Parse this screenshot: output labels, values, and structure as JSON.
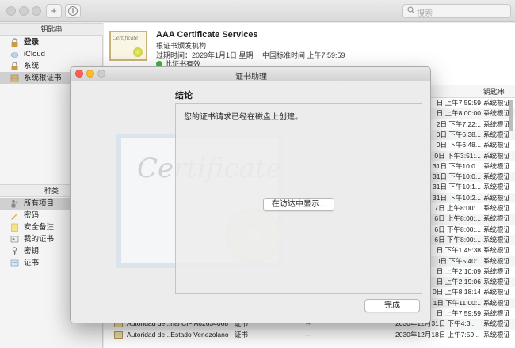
{
  "toolbar": {
    "search_placeholder": "搜索",
    "add_glyph": "+",
    "info_glyph": "i"
  },
  "sidebar": {
    "keychains_header": "钥匙串",
    "keychains": [
      {
        "label": "登录",
        "bold": true,
        "icon": "lock-icon"
      },
      {
        "label": "iCloud",
        "icon": "cloud-icon"
      },
      {
        "label": "系统",
        "icon": "lock-icon"
      },
      {
        "label": "系统根证书",
        "icon": "cabinet-icon",
        "selected": true
      }
    ],
    "categories_header": "种类",
    "categories": [
      {
        "label": "所有项目",
        "icon": "people-icon",
        "selected": true
      },
      {
        "label": "密码",
        "icon": "pencil-icon"
      },
      {
        "label": "安全备注",
        "icon": "note-icon"
      },
      {
        "label": "我的证书",
        "icon": "my-cert-icon"
      },
      {
        "label": "密钥",
        "icon": "key-icon"
      },
      {
        "label": "证书",
        "icon": "certificate-icon"
      }
    ]
  },
  "cert_info": {
    "title": "AAA Certificate Services",
    "subtitle": "根证书颁发机构",
    "expiry": "过期时间：2029年1月1日 星期一 中国标准时间 上午7:59:59",
    "valid": "此证书有效",
    "thumb_text": "Certificate"
  },
  "table": {
    "header_last": "钥匙串",
    "rows": [
      {
        "date": "日 上午7:59:59",
        "keychain": "系统根证"
      },
      {
        "date": "日 上午8:00:00",
        "keychain": "系统根证"
      },
      {
        "date": "2日 下午7:22:..",
        "keychain": "系统根证"
      },
      {
        "date": "0日 下午6:38...",
        "keychain": "系统根证"
      },
      {
        "date": "0日 下午6:48...",
        "keychain": "系统根证"
      },
      {
        "date": "0日 下午3:51:...",
        "keychain": "系统根证"
      },
      {
        "date": "31日 下午10:0...",
        "keychain": "系统根证"
      },
      {
        "date": "31日 下午10:0...",
        "keychain": "系统根证"
      },
      {
        "date": "31日 下午10:1...",
        "keychain": "系统根证"
      },
      {
        "date": "31日 下午10:2...",
        "keychain": "系统根证"
      },
      {
        "date": "7日 上午8:00:...",
        "keychain": "系统根证"
      },
      {
        "date": "6日 上午8:00:...",
        "keychain": "系统根证"
      },
      {
        "date": "6日 下午8:00:...",
        "keychain": "系统根证"
      },
      {
        "date": "6日 下午8:00:...",
        "keychain": "系统根证"
      },
      {
        "date": "日 下午1:45:38",
        "keychain": "系统根证"
      },
      {
        "date": "0日 下午5:40:..",
        "keychain": "系统根证"
      },
      {
        "date": "日 上午2:10:09",
        "keychain": "系统根证"
      },
      {
        "date": "日 上午2:19:06",
        "keychain": "系统根证"
      },
      {
        "date": "0日 上午8:18:14",
        "keychain": "系统根证"
      },
      {
        "date": "1日 下午11:00:..",
        "keychain": "系统根证"
      },
      {
        "date": "日 上午7:59:59",
        "keychain": "系统根证"
      },
      {
        "name": "Autoridad de...nal CIF A62634068",
        "kind": "证书",
        "extra": "--",
        "date": "2030年12月31日 下午4:3...",
        "keychain": "系统根证"
      },
      {
        "name": "Autoridad de...Estado Venezolano",
        "kind": "证书",
        "extra": "--",
        "date": "2030年12月18日 上午7:59...",
        "keychain": "系统根证"
      }
    ]
  },
  "dialog": {
    "title": "证书助理",
    "heading": "结论",
    "message": "您的证书请求已经在磁盘上创建。",
    "show_in_finder": "在访达中显示...",
    "done": "完成",
    "watermark_text": "Certificate"
  },
  "colors": {
    "close": "#ff5f57",
    "minimize": "#febc2e",
    "zoom_inactive": "#cccccc",
    "valid_check": "#3fb53f"
  }
}
